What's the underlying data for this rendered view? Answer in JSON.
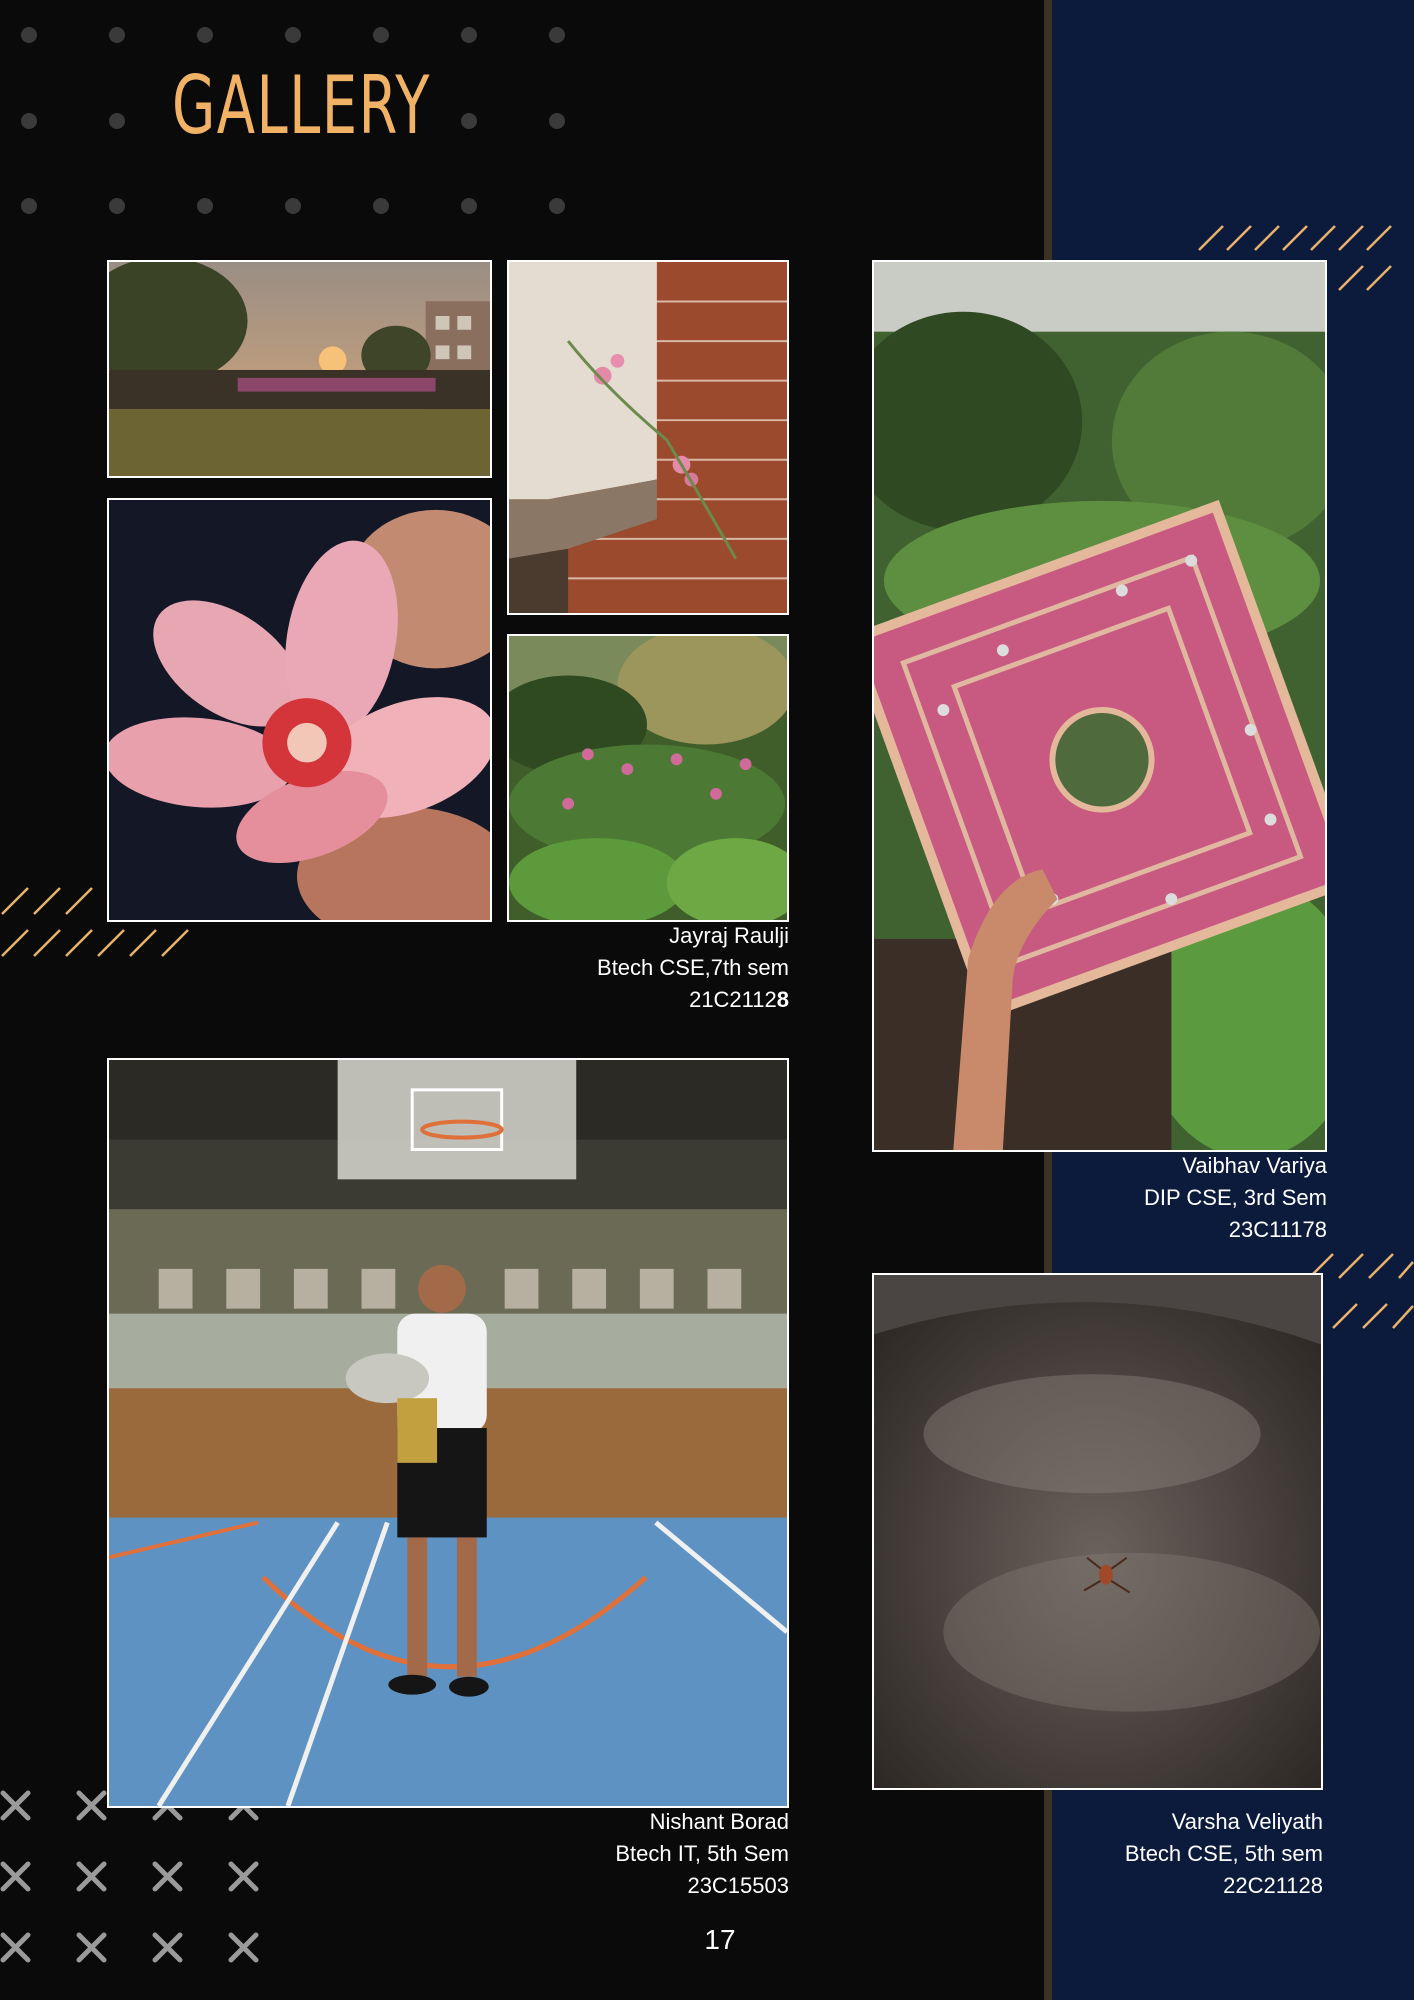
{
  "page": {
    "title": "GALLERY",
    "page_number": "17"
  },
  "colors": {
    "background_left": "#0a0a0a",
    "background_right": "#0c1a3c",
    "divider": "#3d3122",
    "title": "#f2b266",
    "accent_lines": "#e8b26a",
    "dots": "#3a3a3a",
    "crosses": "#9a9a9a",
    "frame": "#ffffff",
    "caption_text": "#ffffff"
  },
  "captions": [
    {
      "name": "Jayraj Raulji",
      "course": "Btech CSE,7th sem",
      "id_prefix": "21C2112",
      "id_suffix": "8"
    },
    {
      "name": "Vaibhav Variya",
      "course": "DIP CSE, 3rd Sem",
      "id": "23C11178"
    },
    {
      "name": "Nishant Borad",
      "course": "Btech IT, 5th Sem",
      "id": "23C15503"
    },
    {
      "name": "Varsha Veliyath",
      "course": "Btech CSE, 5th sem",
      "id": "22C21128"
    }
  ]
}
